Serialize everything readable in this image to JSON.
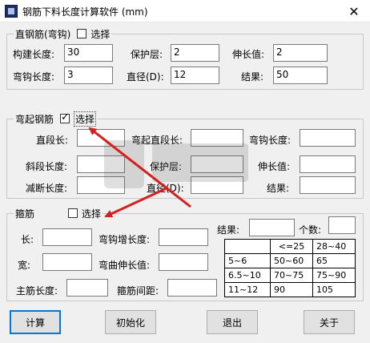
{
  "window": {
    "title": "钢筋下料长度计算软件  (mm)",
    "close_glyph": "✕"
  },
  "straight": {
    "legend": "直钢筋(弯钩)",
    "select_label": "选择",
    "select_checked": false,
    "member_length_label": "构建长度:",
    "member_length_value": "30",
    "cover_label": "保护层:",
    "cover_value": "2",
    "elongation_label": "伸长值:",
    "elongation_value": "2",
    "hook_length_label": "弯钩长度:",
    "hook_length_value": "3",
    "diameter_label": "直径(D):",
    "diameter_value": "12",
    "result_label": "结果:",
    "result_value": "50"
  },
  "bent": {
    "legend": "弯起钢筋",
    "select_label": "选择",
    "select_checked": true,
    "straight_len_label": "直段长:",
    "straight_len_value": "",
    "bent_straight_len_label": "弯起直段长:",
    "bent_straight_len_value": "",
    "hook_len_label": "弯钩长度:",
    "hook_len_value": "",
    "slope_len_label": "斜段长度:",
    "slope_len_value": "",
    "cover_label": "保护层:",
    "cover_value": "",
    "elongation_label": "伸长值:",
    "elongation_value": "",
    "cut_len_label": "减断长度:",
    "cut_len_value": "",
    "diameter_label": "直径(D):",
    "diameter_value": "",
    "result_label": "结果:",
    "result_value": ""
  },
  "stirrup": {
    "legend": "箍筋",
    "select_label": "选择",
    "select_checked": false,
    "length_label": "长:",
    "length_value": "",
    "hook_increase_label": "弯钩增长度:",
    "hook_increase_value": "",
    "width_label": "宽:",
    "width_value": "",
    "bend_elongation_label": "弯曲伸长值:",
    "bend_elongation_value": "",
    "main_bar_len_label": "主筋长度:",
    "main_bar_len_value": "",
    "spacing_label": "箍筋间距:",
    "spacing_value": "",
    "result_label": "结果:",
    "result_value": "",
    "count_label": "个数:",
    "count_value": "",
    "table": [
      [
        "",
        "<=25",
        "28~40"
      ],
      [
        "5~6",
        "50~60",
        "65"
      ],
      [
        "6.5~10",
        "70~75",
        "75~90"
      ],
      [
        "11~12",
        "90",
        "105"
      ]
    ]
  },
  "buttons": {
    "calculate": "计算",
    "initialize": "初始化",
    "exit": "退出",
    "about": "关于"
  },
  "colors": {
    "arrow": "#d42020",
    "accent": "#0078d7"
  }
}
